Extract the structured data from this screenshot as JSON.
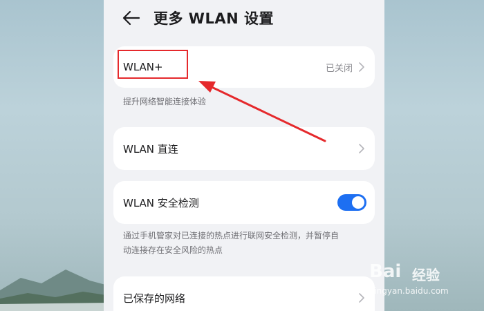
{
  "header": {
    "title": "更多 WLAN 设置",
    "back_icon": "arrow-left-icon"
  },
  "settings": {
    "wlan_plus": {
      "label": "WLAN+",
      "value": "已关闭",
      "hint": "提升网络智能连接体验"
    },
    "wlan_direct": {
      "label": "WLAN 直连"
    },
    "wlan_security": {
      "label": "WLAN 安全检测",
      "enabled": true,
      "hint_line1": "通过手机管家对已连接的热点进行联网安全检测，并暂停自",
      "hint_line2": "动连接存在安全风险的热点"
    },
    "saved_networks": {
      "label": "已保存的网络"
    }
  },
  "annotation": {
    "highlight_color": "#e5292c",
    "arrow_color": "#e5292c"
  },
  "watermark": {
    "logo": "Bai",
    "brand": "经验",
    "url": "jingyan.baidu.com"
  },
  "colors": {
    "toggle_on": "#1d6ff2",
    "page_bg": "#f1f2f5"
  }
}
